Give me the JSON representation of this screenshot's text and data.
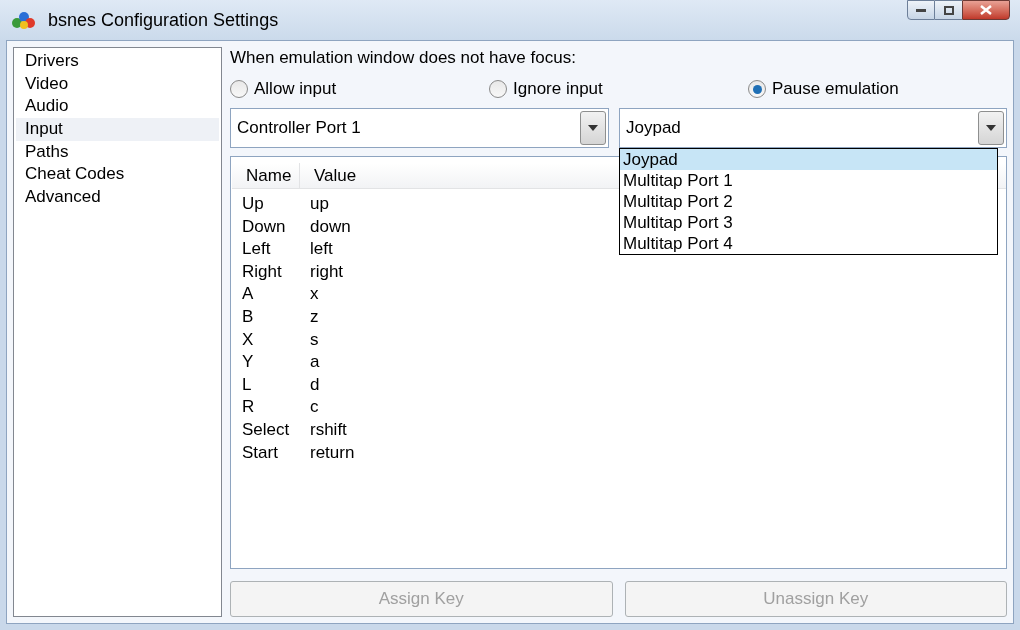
{
  "window": {
    "title": "bsnes Configuration Settings"
  },
  "sidebar": {
    "items": [
      {
        "label": "Drivers",
        "selected": false
      },
      {
        "label": "Video",
        "selected": false
      },
      {
        "label": "Audio",
        "selected": false
      },
      {
        "label": "Input",
        "selected": true
      },
      {
        "label": "Paths",
        "selected": false
      },
      {
        "label": "Cheat Codes",
        "selected": false
      },
      {
        "label": "Advanced",
        "selected": false
      }
    ]
  },
  "focus_label": "When emulation window does not have focus:",
  "focus_options": [
    {
      "label": "Allow input",
      "selected": false
    },
    {
      "label": "Ignore input",
      "selected": false
    },
    {
      "label": "Pause emulation",
      "selected": true
    }
  ],
  "port_select": {
    "value": "Controller Port 1"
  },
  "device_select": {
    "value": "Joypad",
    "expanded": true,
    "options": [
      {
        "label": "Joypad",
        "selected": true
      },
      {
        "label": "Multitap Port 1",
        "selected": false
      },
      {
        "label": "Multitap Port 2",
        "selected": false
      },
      {
        "label": "Multitap Port 3",
        "selected": false
      },
      {
        "label": "Multitap Port 4",
        "selected": false
      }
    ]
  },
  "table": {
    "columns": [
      "Name",
      "Value"
    ],
    "rows": [
      [
        "Up",
        "up"
      ],
      [
        "Down",
        "down"
      ],
      [
        "Left",
        "left"
      ],
      [
        "Right",
        "right"
      ],
      [
        "A",
        "x"
      ],
      [
        "B",
        "z"
      ],
      [
        "X",
        "s"
      ],
      [
        "Y",
        "a"
      ],
      [
        "L",
        "d"
      ],
      [
        "R",
        "c"
      ],
      [
        "Select",
        "rshift"
      ],
      [
        "Start",
        "return"
      ]
    ]
  },
  "buttons": [
    {
      "label": "Assign Key",
      "disabled": true
    },
    {
      "label": "Unassign Key",
      "disabled": true
    }
  ]
}
